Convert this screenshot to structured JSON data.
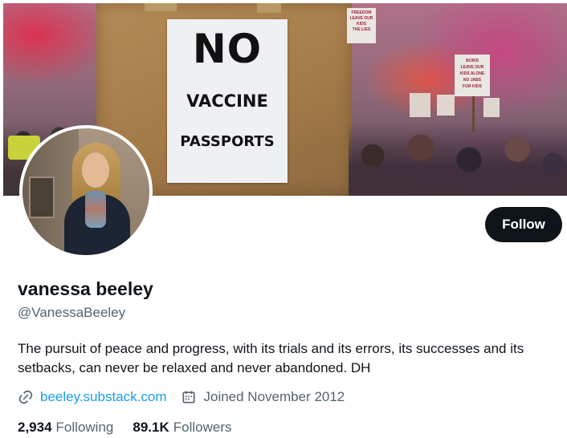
{
  "banner": {
    "poster": {
      "line1": "NO",
      "line2": "VACCINE",
      "line3": "PASSPORTS"
    },
    "sign_left": "FREEDOM\nLEAVE OUR\nKIDS\nTHE LIES",
    "sign_right": "BORIS\nLEAVE OUR\nKIDS ALONE\nNO JABS\nFOR KIDS"
  },
  "profile": {
    "follow_label": "Follow",
    "display_name": "vanessa beeley",
    "handle": "@VanessaBeeley",
    "bio": "The pursuit of peace and progress, with its trials and its errors, its successes and its setbacks, can never be relaxed and never abandoned. DH",
    "website": "beeley.substack.com",
    "joined": "Joined November 2012",
    "following_count": "2,934",
    "following_label": "Following",
    "followers_count": "89.1K",
    "followers_label": "Followers"
  },
  "colors": {
    "follow_bg": "#0f1419",
    "link": "#1d9bf0",
    "secondary_text": "#536471"
  },
  "icons": {
    "link": "link-icon",
    "calendar": "calendar-icon"
  }
}
